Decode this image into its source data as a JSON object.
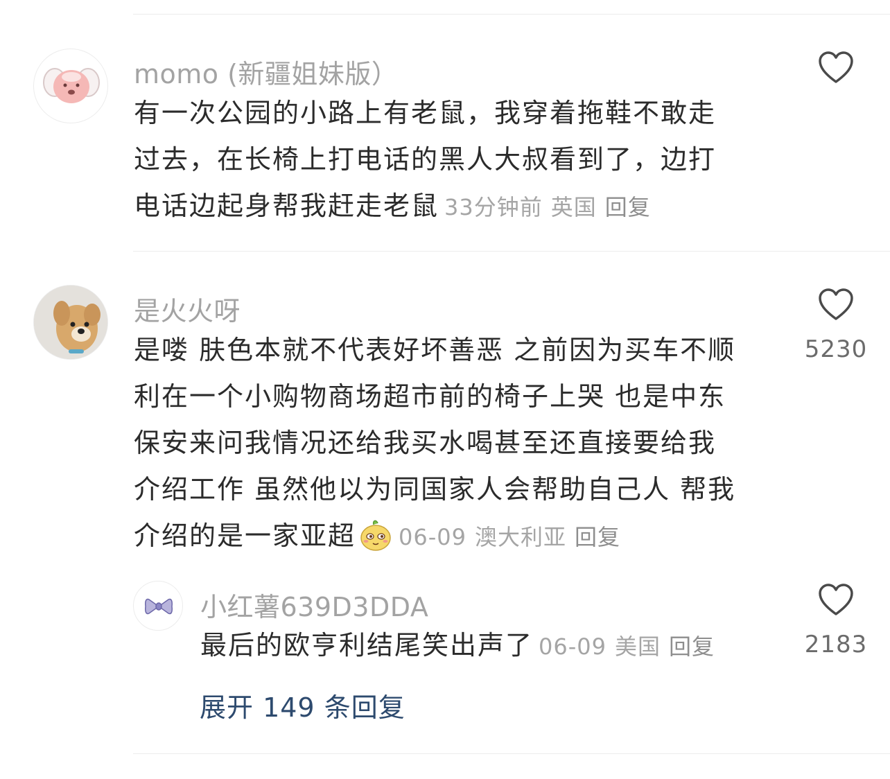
{
  "comments": [
    {
      "author": "momo (新疆姐妹版）",
      "text": "有一次公园的小路上有老鼠，我穿着拖鞋不敢走过去，在长椅上打电话的黑人大叔看到了，边打电话边起身帮我赶走老鼠",
      "lines": [
        "有一次公园的小路上有老鼠，我穿着拖鞋不敢走",
        "过去，在长椅上打电话的黑人大叔看到了，边打",
        "电话边起身帮我赶走老鼠"
      ],
      "time": "33分钟前",
      "location": "英国",
      "reply_label": "回复",
      "likes": "",
      "avatar_icon": "pink-puppy-avatar"
    },
    {
      "author": "是火火呀",
      "lines": [
        "是喽 肤色本就不代表好坏善恶 之前因为买车不顺",
        "利在一个小购物商场超市前的椅子上哭 也是中东",
        "保安来问我情况还给我买水喝甚至还直接要给我",
        "介绍工作 虽然他以为同国家人会帮助自己人 帮我",
        "介绍的是一家亚超"
      ],
      "time": "06-09",
      "location": "澳大利亚",
      "reply_label": "回复",
      "likes": "5230",
      "avatar_icon": "dog-photo-avatar",
      "emoji": "smirk-fruit-emoji"
    }
  ],
  "sub_reply": {
    "author": "小红薯639D3DDA",
    "text": "最后的欧亨利结尾笑出声了",
    "time": "06-09",
    "location": "美国",
    "reply_label": "回复",
    "likes": "2183",
    "avatar_icon": "bow-avatar"
  },
  "expand_label": "展开 149 条回复",
  "colors": {
    "author": "#a3a3a3",
    "meta": "#a5a5a5",
    "expand": "#2d4a6e",
    "divider": "#ececec"
  }
}
